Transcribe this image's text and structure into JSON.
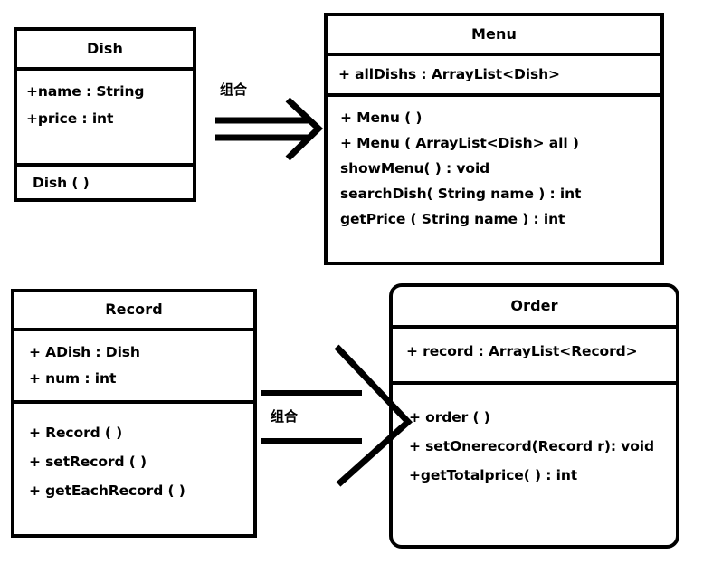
{
  "diagram": {
    "title": "UML class diagram",
    "stroke_color": "#000000",
    "background_color": "#ffffff"
  },
  "classes": {
    "dish": {
      "name": "Dish",
      "attributes": [
        "+name : String",
        "+price : int"
      ],
      "operations": [
        "Dish ( )"
      ]
    },
    "menu": {
      "name": "Menu",
      "attributes": [
        "+ allDishs  : ArrayList<Dish>"
      ],
      "operations": [
        "+ Menu ( )",
        "+ Menu ( ArrayList<Dish>  all )",
        "showMenu( ) : void",
        "searchDish( String name ) : int",
        "getPrice ( String name ) : int"
      ]
    },
    "record": {
      "name": "Record",
      "attributes": [
        "+ ADish :  Dish",
        "+ num  :  int"
      ],
      "operations": [
        "+ Record ( )",
        "+ setRecord ( )",
        "+ getEachRecord ( )"
      ]
    },
    "order": {
      "name": "Order",
      "attributes": [
        "+ record : ArrayList<Record>"
      ],
      "operations": [
        "+ order ( )",
        "+ setOnerecord(Record r): void",
        "+getTotalprice( ) :  int"
      ]
    }
  },
  "relations": {
    "dish_to_menu": {
      "label": "组合",
      "from": "Dish",
      "to": "Menu",
      "kind": "composition"
    },
    "record_to_order": {
      "label": "组合",
      "from": "Record",
      "to": "Order",
      "kind": "composition"
    }
  }
}
